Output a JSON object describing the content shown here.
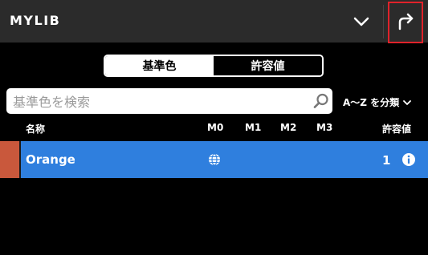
{
  "header": {
    "title": "MYLIB",
    "chevron_icon": "chevron-down-icon",
    "share_icon": "redo-arrow-icon"
  },
  "segment": {
    "items": [
      {
        "label": "基準色",
        "active": true
      },
      {
        "label": "許容値",
        "active": false
      }
    ]
  },
  "search": {
    "placeholder": "基準色を検索",
    "value": "",
    "icon": "search-icon"
  },
  "sort": {
    "label": "A〜Z を分類",
    "icon": "chevron-down-icon"
  },
  "columns": {
    "name": "名称",
    "m0": "M0",
    "m1": "M1",
    "m2": "M2",
    "m3": "M3",
    "tolerance": "許容値"
  },
  "rows": [
    {
      "swatch_color": "#c9583c",
      "name": "Orange",
      "m0_icon": "globe-icon",
      "tolerance": "1",
      "info_icon": "info-icon"
    }
  ],
  "colors": {
    "header_bg": "#2b2b2b",
    "accent": "#2f7fde",
    "highlight_border": "#e0222a"
  }
}
